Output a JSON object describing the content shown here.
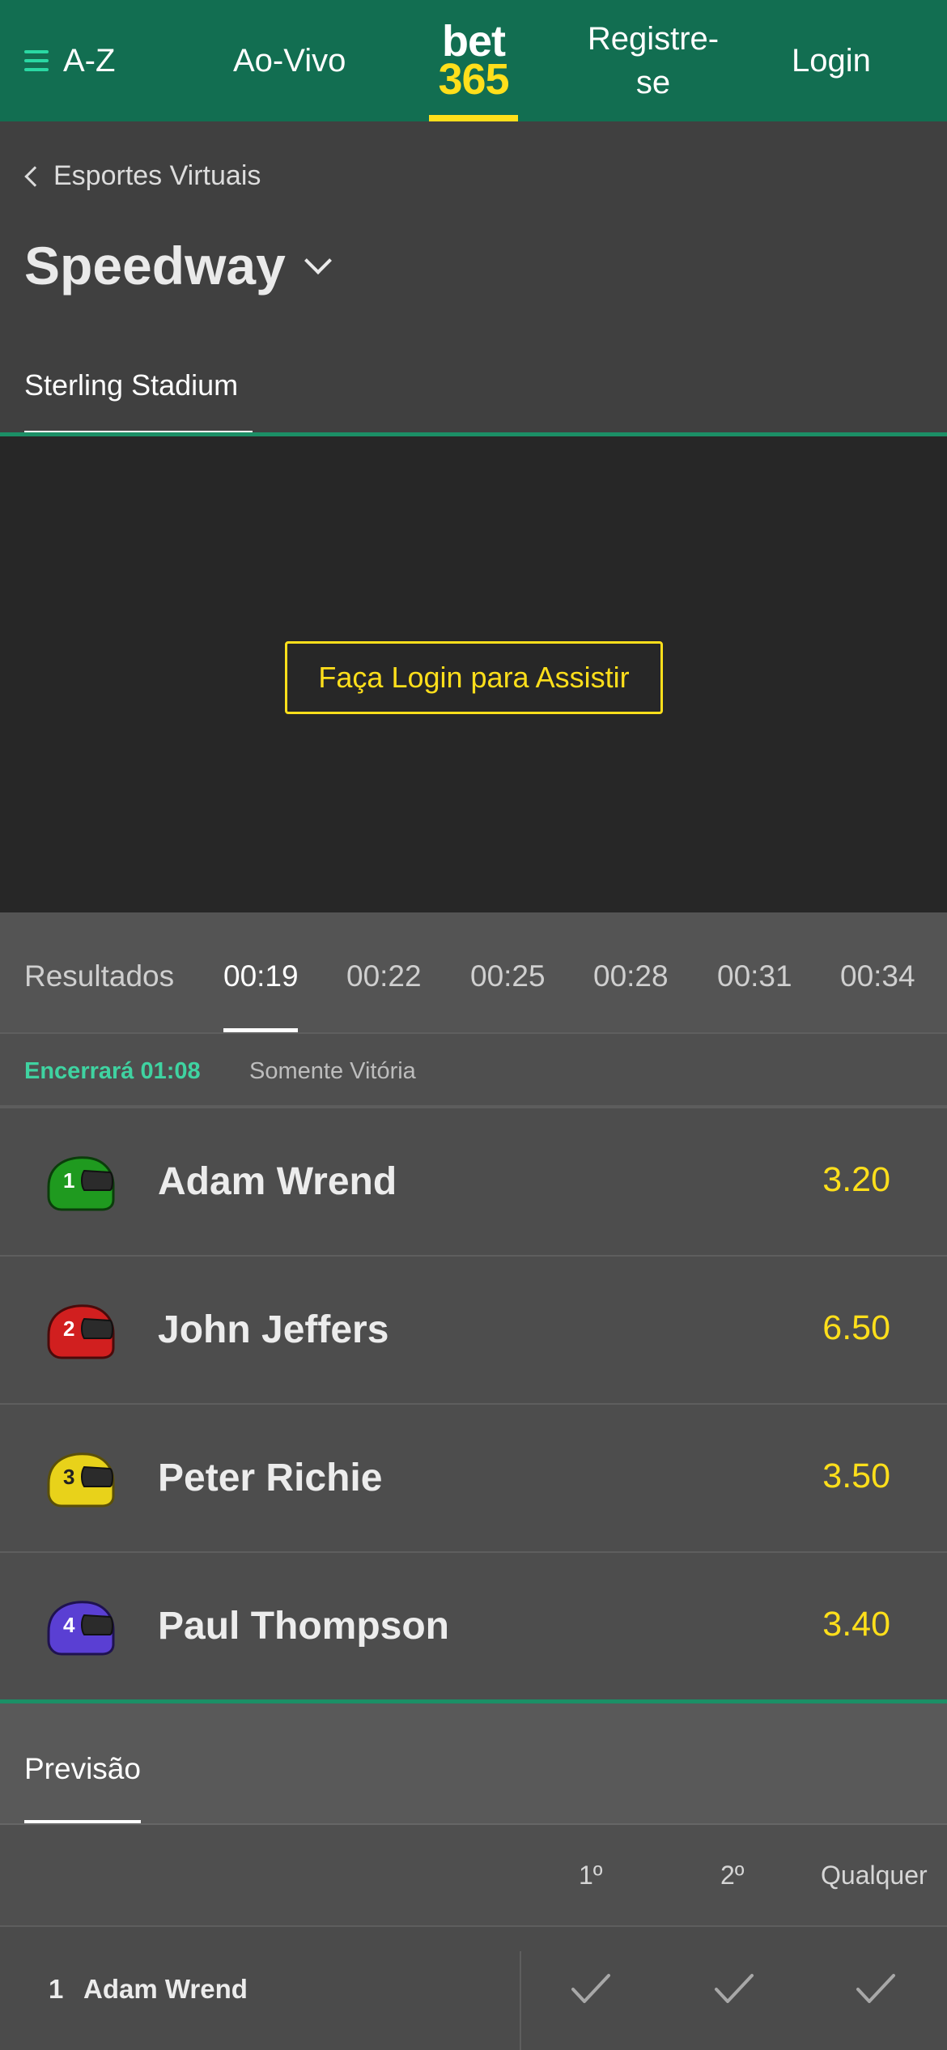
{
  "header": {
    "menu_label": "A-Z",
    "live_label": "Ao-Vivo",
    "logo_top": "bet",
    "logo_bottom": "365",
    "register_label": "Registre-\nse",
    "login_label": "Login",
    "brand_green": "#126e51",
    "brand_yellow": "#ffdf1b"
  },
  "breadcrumb": {
    "back_label": "Esportes Virtuais"
  },
  "page": {
    "title": "Speedway",
    "venue_tab": "Sterling Stadium"
  },
  "video": {
    "watch_button": "Faça Login para Assistir"
  },
  "race_tabs": [
    "Resultados",
    "00:19",
    "00:22",
    "00:25",
    "00:28",
    "00:31",
    "00:34"
  ],
  "race_tabs_active": "00:19",
  "market_info": {
    "closes": "Encerrará 01:08",
    "market_type": "Somente Vitória"
  },
  "runners": [
    {
      "number": "1",
      "name": "Adam Wrend",
      "odds": "3.20",
      "helmet_color": "#1f9a1f",
      "icon": "green-helmet-icon"
    },
    {
      "number": "2",
      "name": "John Jeffers",
      "odds": "6.50",
      "helmet_color": "#d11f1f",
      "icon": "red-helmet-icon"
    },
    {
      "number": "3",
      "name": "Peter Richie",
      "odds": "3.50",
      "helmet_color": "#e8d21a",
      "icon": "yellow-helmet-icon"
    },
    {
      "number": "4",
      "name": "Paul Thompson",
      "odds": "3.40",
      "helmet_color": "#5a3fd3",
      "icon": "purple-helmet-icon"
    }
  ],
  "forecast": {
    "tab_label": "Previsão",
    "columns": [
      "1º",
      "2º",
      "Qualquer"
    ],
    "rows": [
      {
        "number": "1",
        "name": "Adam Wrend"
      }
    ]
  }
}
